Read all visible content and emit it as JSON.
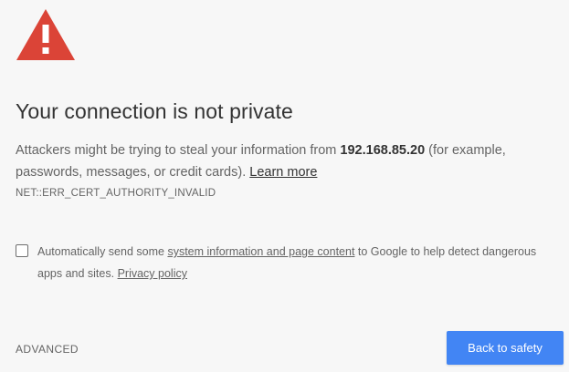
{
  "warning_icon": "warning-triangle-icon",
  "colors": {
    "icon_red": "#db4437",
    "button_blue": "#4285f4"
  },
  "heading": "Your connection is not private",
  "message": {
    "prefix": "Attackers might be trying to steal your information from ",
    "host": "192.168.85.20",
    "suffix": " (for example, passwords, messages, or credit cards). ",
    "learn_more": "Learn more"
  },
  "error_code": "NET::ERR_CERT_AUTHORITY_INVALID",
  "optin": {
    "checked": false,
    "prefix": "Automatically send some ",
    "link": "system information and page content",
    "middle": " to Google to help detect dangerous apps and sites. ",
    "privacy": "Privacy policy"
  },
  "advanced_label": "ADVANCED",
  "back_label": "Back to safety"
}
